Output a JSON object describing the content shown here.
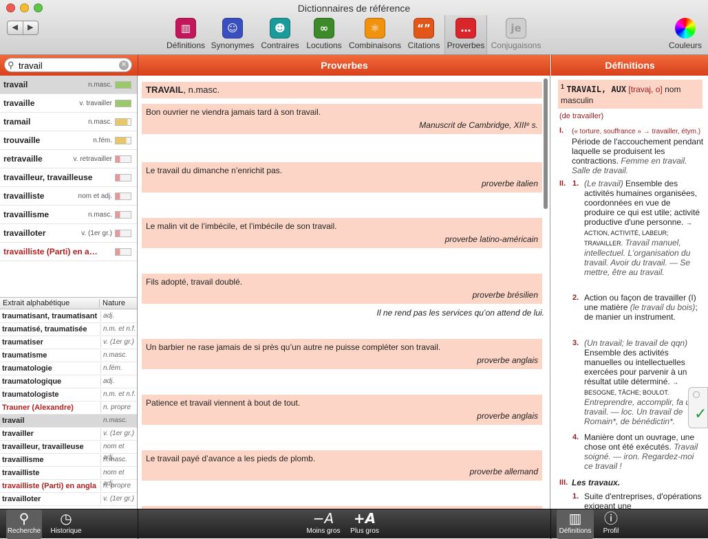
{
  "window": {
    "title": "Dictionnaires de référence"
  },
  "nav": {
    "back": "◀",
    "forward": "▶"
  },
  "toolbar": [
    {
      "label": "Définitions",
      "icon": "book-icon",
      "glyph": "▥",
      "color": "#c2185b"
    },
    {
      "label": "Synonymes",
      "icon": "masks-icon",
      "glyph": "☺",
      "color": "#3a4fbf"
    },
    {
      "label": "Contraires",
      "icon": "theater-icon",
      "glyph": "☻",
      "color": "#1a9a9a"
    },
    {
      "label": "Locutions",
      "icon": "link-icon",
      "glyph": "∞",
      "color": "#3d8a2a"
    },
    {
      "label": "Combinaisons",
      "icon": "atom-icon",
      "glyph": "⚛",
      "color": "#f0920e"
    },
    {
      "label": "Citations",
      "icon": "quote-icon",
      "glyph": "“”",
      "color": "#e2561a"
    },
    {
      "label": "Proverbes",
      "icon": "speech-bubble-icon",
      "glyph": "…",
      "color": "#d9262b"
    },
    {
      "label": "Conjugaisons",
      "icon": "conjugation-icon",
      "glyph": "je",
      "color": "#cfcfcf"
    }
  ],
  "colors_btn": {
    "label": "Couleurs"
  },
  "search": {
    "value": "travail"
  },
  "columns": {
    "center": "Proverbes",
    "right": "Définitions"
  },
  "results": [
    {
      "word": "travail",
      "gram": "n.masc.",
      "level": 1.0,
      "red": false
    },
    {
      "word": "travaille",
      "gram": "v. travailler",
      "level": 1.0,
      "red": false
    },
    {
      "word": "tramail",
      "gram": "n.masc.",
      "level": 0.8,
      "red": false
    },
    {
      "word": "trouvaille",
      "gram": "n.fém.",
      "level": 0.7,
      "red": false
    },
    {
      "word": "retravaille",
      "gram": "v. retravailler",
      "level": 0.3,
      "red": false
    },
    {
      "word": "travailleur, travailleuse",
      "gram": "",
      "level": 0.3,
      "red": false
    },
    {
      "word": "travailliste",
      "gram": "nom et adj.",
      "level": 0.3,
      "red": false
    },
    {
      "word": "travaillisme",
      "gram": "n.masc.",
      "level": 0.3,
      "red": false
    },
    {
      "word": "travailloter",
      "gram": "v. (1er gr.)",
      "level": 0.3,
      "red": false
    },
    {
      "word": "travailliste (Parti) en angl…",
      "gram": "",
      "level": 0.3,
      "red": true
    }
  ],
  "alpha_header": {
    "col1": "Extrait alphabétique",
    "col2": "Nature"
  },
  "alpha": [
    {
      "word": "traumatisant, traumatisant",
      "nature": "adj.",
      "red": false
    },
    {
      "word": "traumatisé, traumatisée",
      "nature": "n.m. et n.f.",
      "red": false
    },
    {
      "word": "traumatiser",
      "nature": "v. (1er gr.)",
      "red": false
    },
    {
      "word": "traumatisme",
      "nature": "n.masc.",
      "red": false
    },
    {
      "word": "traumatologie",
      "nature": "n.fém.",
      "red": false
    },
    {
      "word": "traumatologique",
      "nature": "adj.",
      "red": false
    },
    {
      "word": "traumatologiste",
      "nature": "n.m. et n.f.",
      "red": false
    },
    {
      "word": "Trauner (Alexandre)",
      "nature": "n. propre",
      "red": true
    },
    {
      "word": "travail",
      "nature": "n.masc.",
      "red": false
    },
    {
      "word": "travailler",
      "nature": "v. (1er gr.)",
      "red": false
    },
    {
      "word": "travailleur, travailleuse",
      "nature": "nom et adj.",
      "red": false
    },
    {
      "word": "travaillisme",
      "nature": "n.masc.",
      "red": false
    },
    {
      "word": "travailliste",
      "nature": "nom et adj.",
      "red": false
    },
    {
      "word": "travailliste (Parti) en angla",
      "nature": "n. propre",
      "red": true
    },
    {
      "word": "travailloter",
      "nature": "v. (1er gr.)",
      "red": false
    }
  ],
  "proverbes": {
    "entry_word": "TRAVAIL",
    "entry_gram": ", n.masc.",
    "items": [
      {
        "text": "Bon ouvrier ne viendra jamais tard à son travail.",
        "source": "Manuscrit de Cambridge, XIIIᵉ s.",
        "gloss": ""
      },
      {
        "text": "Le travail du dimanche n’enrichit pas.",
        "source": "proverbe italien",
        "gloss": ""
      },
      {
        "text": "Le malin vit de l’imbécile, et l’imbécile de son travail.",
        "source": "proverbe latino-américain",
        "gloss": ""
      },
      {
        "text": "Fils adopté, travail doublé.",
        "source": "proverbe brésilien",
        "gloss": "Il ne rend pas les services qu’on attend de lui."
      },
      {
        "text": "Un barbier ne rase jamais de si près qu’un autre ne puisse compléter son travail.",
        "source": "proverbe anglais",
        "gloss": ""
      },
      {
        "text": "Patience et travail viennent à bout de tout.",
        "source": "proverbe anglais",
        "gloss": ""
      },
      {
        "text": "Le travail payé d’avance a les pieds de plomb.",
        "source": "proverbe allemand",
        "gloss": ""
      }
    ]
  },
  "definition": {
    "sup": "1",
    "head": "TRAVAIL, AUX",
    "pron": "[travaj, o]",
    "gram": "nom masculin",
    "origin": "(de travailler)",
    "s1_num": "I.",
    "s1_etym": "(« torture, souffrance » → travailler, étym.)",
    "s1_text": "Période de l'accouchement pendant laquelle se produisent les contractions.",
    "s1_ex": "Femme en travail. Salle de travail.",
    "s2_num": "II.",
    "s2a_num": "1.",
    "s2a_lead": "(Le travail)",
    "s2a_text": "Ensemble des activités humaines organisées, coordonnées en vue de produire ce qui est utile; activité productive d'une personne.",
    "s2a_syn": "→ ACTION, ACTIVITÉ, LABEUR; TRAVAILLER.",
    "s2a_ex": "Travail manuel, intellectuel. L'organisation du travail. Avoir du travail. — Se mettre, être au travail.",
    "s2b_num": "2.",
    "s2b_text": "Action ou façon de travailler (I) une matière",
    "s2b_paren": "(le travail du bois)",
    "s2b_tail": "; de manier un instrument.",
    "s2c_num": "3.",
    "s2c_lead": "(Un travail; le travail de qqn)",
    "s2c_text": "Ensemble des activités manuelles ou intellectuelles exercées pour parvenir à un résultat utile déterminé.",
    "s2c_syn": "→ BESOGNE, TÂCHE; BOULOT.",
    "s2c_ex": "Entreprendre, accomplir, fa un travail. — loc. Un travail de Romain*, de bénédictin*.",
    "s2d_num": "4.",
    "s2d_text": "Manière dont un ouvrage, une chose ont été exécutés.",
    "s2d_ex": "Travail soigné. — iron. Regardez-moi ce travail !",
    "s3_num": "III.",
    "s3_lead": "Les travaux.",
    "s3a_num": "1.",
    "s3a_text": "Suite d'entreprises, d'opérations exigeant une"
  },
  "bottom": {
    "search": "Recherche",
    "history": "Historique",
    "smaller": "Moins gros",
    "bigger": "Plus gros",
    "definitions": "Définitions",
    "profile": "Profil"
  }
}
